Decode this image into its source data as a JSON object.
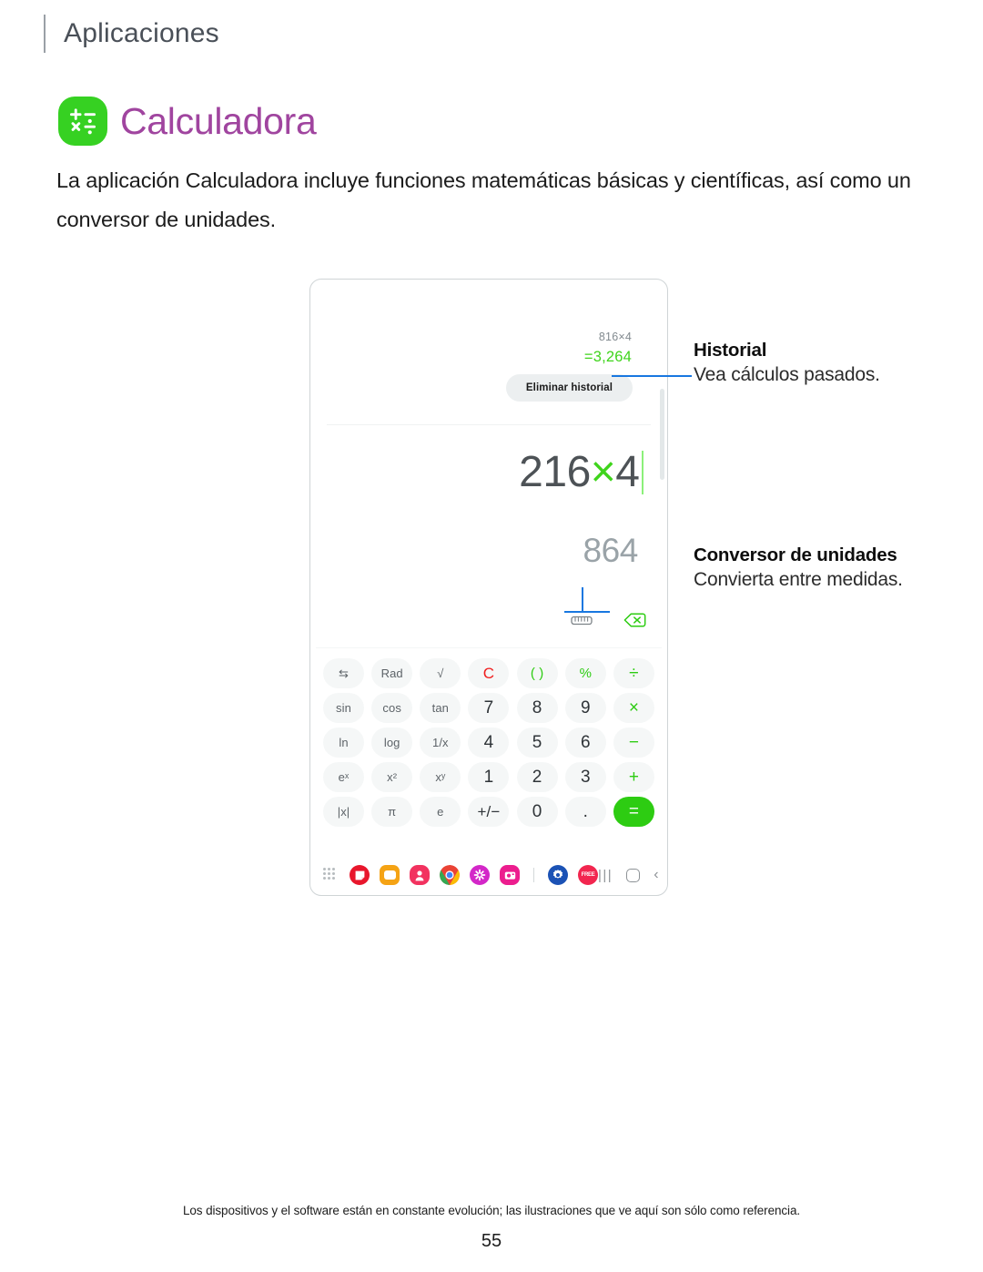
{
  "header": {
    "section": "Aplicaciones"
  },
  "app": {
    "title": "Calculadora",
    "icon": "calculator-icon",
    "icon_color": "#36d122",
    "title_color": "#a0459f",
    "description": "La aplicación Calculadora incluye funciones matemáticas básicas y científicas, así como un conversor de unidades."
  },
  "device": {
    "history": {
      "expression": "816×4",
      "result": "=3,264",
      "result_color": "#3fd41c",
      "clear_button": "Eliminar historial"
    },
    "display": {
      "expression_left": "216",
      "expression_op": "×",
      "expression_right": "4",
      "result": "864",
      "tools": [
        {
          "name": "unit-converter-icon",
          "label": "ruler"
        },
        {
          "name": "backspace-icon",
          "label": "backspace"
        }
      ]
    },
    "keypad": [
      [
        {
          "label": "⇆",
          "name": "key-swap",
          "style": "fn"
        },
        {
          "label": "Rad",
          "name": "key-rad",
          "style": "fn"
        },
        {
          "label": "√",
          "name": "key-sqrt",
          "style": "fn"
        },
        {
          "label": "C",
          "name": "key-clear",
          "style": "fn-red"
        },
        {
          "label": "( )",
          "name": "key-parenthesis",
          "style": "fn-green"
        },
        {
          "label": "%",
          "name": "key-percent",
          "style": "fn-green"
        },
        {
          "label": "÷",
          "name": "key-divide",
          "style": "op"
        }
      ],
      [
        {
          "label": "sin",
          "name": "key-sin",
          "style": "fn"
        },
        {
          "label": "cos",
          "name": "key-cos",
          "style": "fn"
        },
        {
          "label": "tan",
          "name": "key-tan",
          "style": "fn"
        },
        {
          "label": "7",
          "name": "key-7",
          "style": "num"
        },
        {
          "label": "8",
          "name": "key-8",
          "style": "num"
        },
        {
          "label": "9",
          "name": "key-9",
          "style": "num"
        },
        {
          "label": "×",
          "name": "key-multiply",
          "style": "op"
        }
      ],
      [
        {
          "label": "ln",
          "name": "key-ln",
          "style": "fn"
        },
        {
          "label": "log",
          "name": "key-log",
          "style": "fn"
        },
        {
          "label": "1/x",
          "name": "key-reciprocal",
          "style": "fn"
        },
        {
          "label": "4",
          "name": "key-4",
          "style": "num"
        },
        {
          "label": "5",
          "name": "key-5",
          "style": "num"
        },
        {
          "label": "6",
          "name": "key-6",
          "style": "num"
        },
        {
          "label": "−",
          "name": "key-minus",
          "style": "op"
        }
      ],
      [
        {
          "label": "eˣ",
          "name": "key-exp",
          "style": "fn"
        },
        {
          "label": "x²",
          "name": "key-square",
          "style": "fn"
        },
        {
          "label": "xʸ",
          "name": "key-power",
          "style": "fn"
        },
        {
          "label": "1",
          "name": "key-1",
          "style": "num"
        },
        {
          "label": "2",
          "name": "key-2",
          "style": "num"
        },
        {
          "label": "3",
          "name": "key-3",
          "style": "num"
        },
        {
          "label": "+",
          "name": "key-plus",
          "style": "op"
        }
      ],
      [
        {
          "label": "|x|",
          "name": "key-abs",
          "style": "fn"
        },
        {
          "label": "π",
          "name": "key-pi",
          "style": "fn"
        },
        {
          "label": "e",
          "name": "key-e",
          "style": "fn"
        },
        {
          "label": "+/−",
          "name": "key-sign",
          "style": "wide"
        },
        {
          "label": "0",
          "name": "key-0",
          "style": "num"
        },
        {
          "label": ".",
          "name": "key-decimal",
          "style": "num"
        },
        {
          "label": "=",
          "name": "key-equals",
          "style": "equals"
        }
      ]
    ],
    "taskbar": {
      "apps_grid": "apps-grid-icon",
      "icons": [
        {
          "name": "notes-icon",
          "color": "#e8162c"
        },
        {
          "name": "my-files-icon",
          "color": "#f5a314"
        },
        {
          "name": "contacts-icon",
          "color": "#f2325f"
        },
        {
          "name": "chrome-icon",
          "color": "#ea4335"
        },
        {
          "name": "snowflake-icon",
          "color": "#d327c8"
        },
        {
          "name": "gallery-icon",
          "color": "#ec1d8e"
        },
        {
          "name": "settings-icon",
          "color": "#1b52b5"
        },
        {
          "name": "free-badge-icon",
          "color": "#f2264f"
        }
      ],
      "nav": {
        "recents": "|||",
        "home": "home-button",
        "back": "‹"
      }
    }
  },
  "callouts": [
    {
      "title": "Historial",
      "body": "Vea cálculos pasados.",
      "accent": "#1877e0"
    },
    {
      "title": "Conversor de unidades",
      "body": "Convierta entre medidas.",
      "accent": "#1877e0"
    }
  ],
  "footer": {
    "note": "Los dispositivos y el software están en constante evolución; las ilustraciones que ve aquí son sólo como referencia.",
    "page_number": "55"
  }
}
